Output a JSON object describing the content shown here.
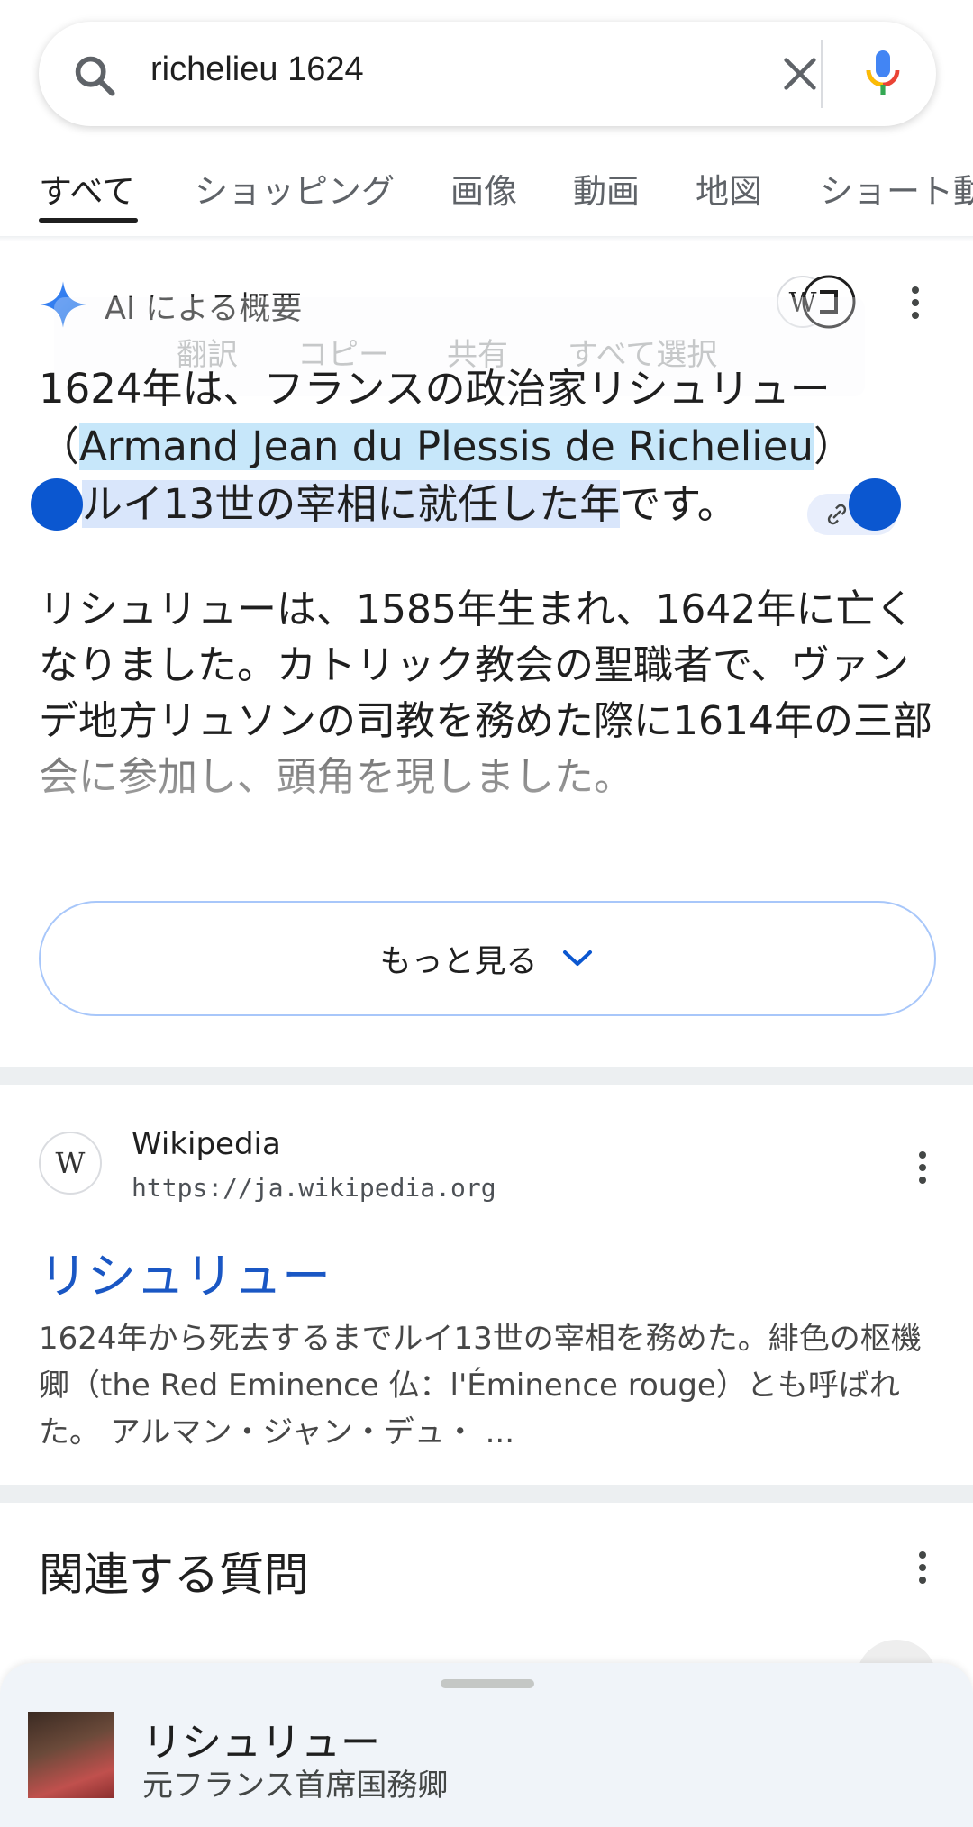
{
  "search": {
    "query": "richelieu 1624"
  },
  "tabs": [
    "すべて",
    "ショッピング",
    "画像",
    "動画",
    "地図",
    "ショート動"
  ],
  "ai_overview": {
    "title": "AI による概要",
    "toolbar": [
      "翻訳",
      "コピー",
      "共有",
      "すべて選択"
    ],
    "line1": "1624年は、フランスの政治家リシュリュー",
    "line2_open": "（",
    "line2_sel": "Armand Jean du Plessis de Richelieu",
    "line2_close": "）",
    "line3_sel": "ルイ13世の宰相に就任した年",
    "line3_rest": "です。",
    "para2": "リシュリューは、1585年生まれ、1642年に亡くなりました。カトリック教会の聖職者で、ヴァンデ地方リュソンの司教を務めた際に1614年の三部会に参加し、頭角を現しました。",
    "more_label": "もっと見る"
  },
  "result": {
    "favicon": "W",
    "site": "Wikipedia",
    "url": "https://ja.wikipedia.org",
    "title": "リシュリュー",
    "snippet": "1624年から死去するまでルイ13世の宰相を務めた。緋色の枢機卿（the Red Eminence 仏：l'Éminence rouge）とも呼ばれた。 アルマン・ジャン・デュ・ ..."
  },
  "related": {
    "title": "関連する質問"
  },
  "sheet": {
    "title": "リシュリュー",
    "subtitle": "元フランス首席国務卿"
  },
  "colors": {
    "accent": "#0b57d0",
    "link": "#1a57c4",
    "selection": "#c7e7fa"
  }
}
